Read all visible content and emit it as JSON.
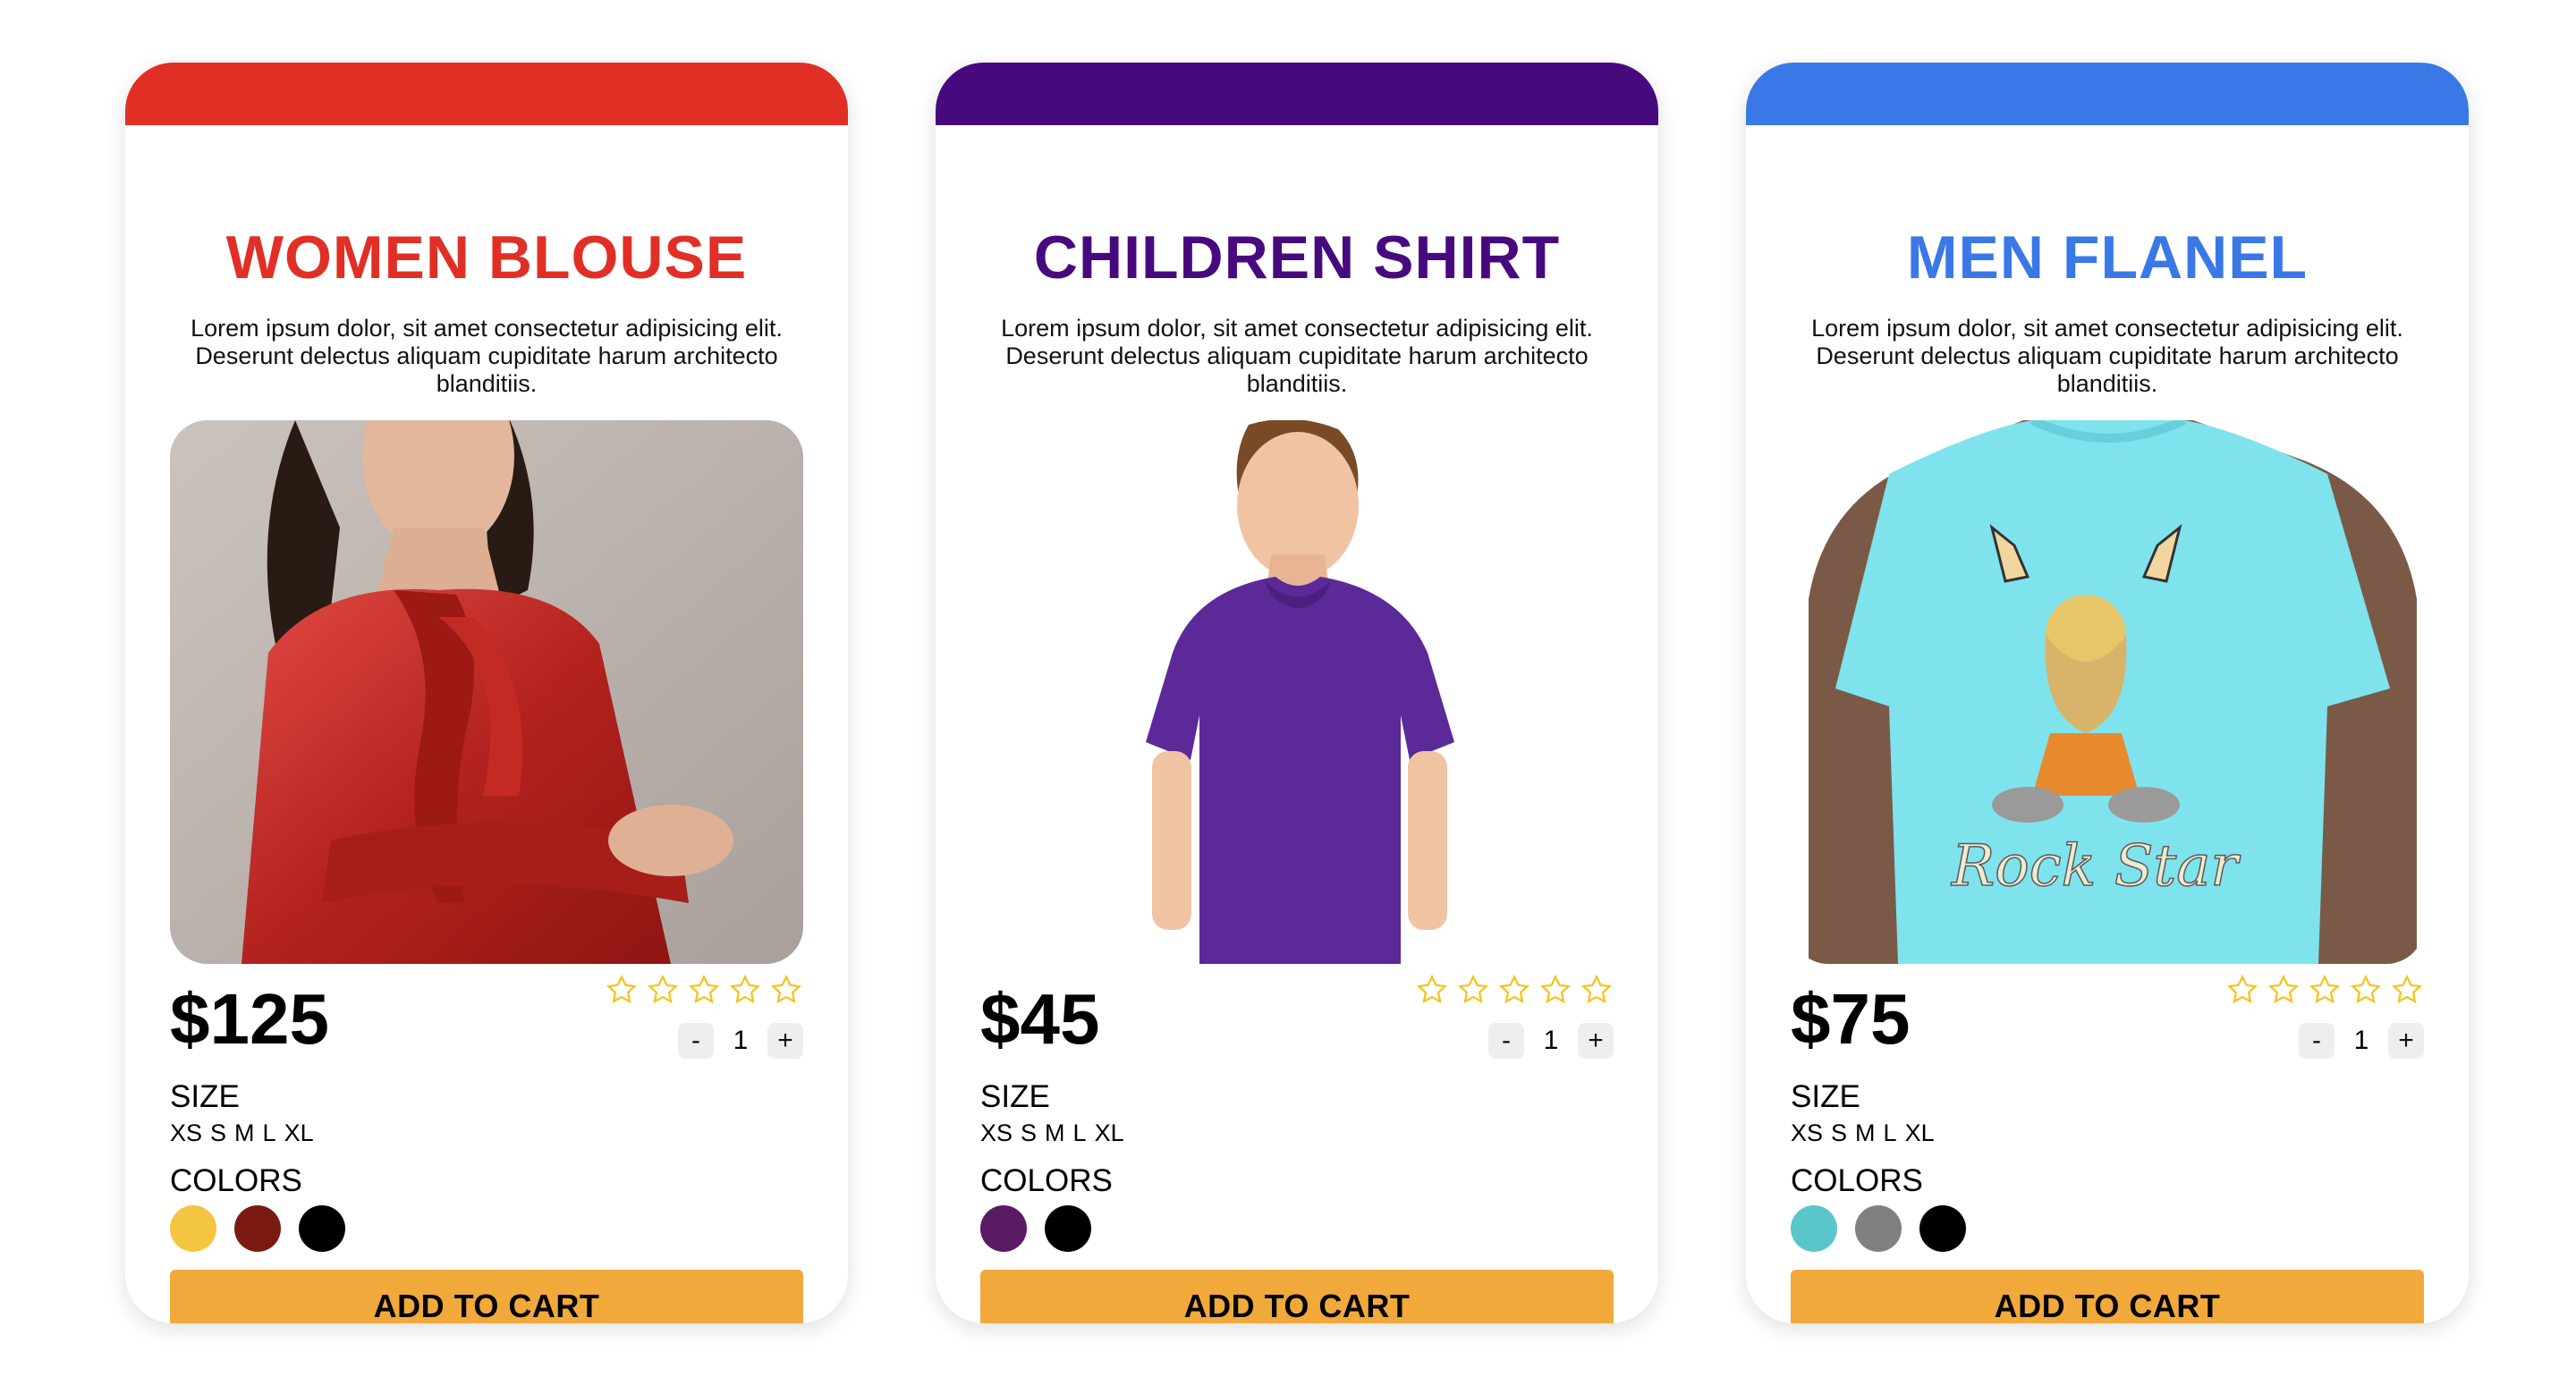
{
  "products": [
    {
      "title": "WOMEN BLOUSE",
      "accent": "#e12f25",
      "description": "Lorem ipsum dolor, sit amet consectetur adipisicing elit. Deserunt delectus aliquam cupiditate harum architecto blanditiis.",
      "image_icon": "woman-red-blouse-photo",
      "price": "$125",
      "rating_stars": 5,
      "quantity": "1",
      "qty_minus": "-",
      "qty_plus": "+",
      "size_label": "SIZE",
      "sizes": [
        "XS",
        "S",
        "M",
        "L",
        "XL"
      ],
      "colors_label": "COLORS",
      "colors": [
        "#f4c542",
        "#7b1a10",
        "#000000"
      ],
      "cart_label": "ADD TO CART"
    },
    {
      "title": "CHILDREN SHIRT",
      "accent": "#470a7e",
      "description": "Lorem ipsum dolor, sit amet consectetur adipisicing elit. Deserunt delectus aliquam cupiditate harum architecto blanditiis.",
      "image_icon": "boy-purple-shirt-photo",
      "price": "$45",
      "rating_stars": 5,
      "quantity": "1",
      "qty_minus": "-",
      "qty_plus": "+",
      "size_label": "SIZE",
      "sizes": [
        "XS",
        "S",
        "M",
        "L",
        "XL"
      ],
      "colors_label": "COLORS",
      "colors": [
        "#5a1a64",
        "#000000"
      ],
      "cart_label": "ADD TO CART"
    },
    {
      "title": "MEN FLANEL",
      "accent": "#3a78e8",
      "description": "Lorem ipsum dolor, sit amet consectetur adipisicing elit. Deserunt delectus aliquam cupiditate harum architecto blanditiis.",
      "image_icon": "cyan-tshirt-photo",
      "image_text": "Rock Star",
      "price": "$75",
      "rating_stars": 5,
      "quantity": "1",
      "qty_minus": "-",
      "qty_plus": "+",
      "size_label": "SIZE",
      "sizes": [
        "XS",
        "S",
        "M",
        "L",
        "XL"
      ],
      "colors_label": "COLORS",
      "colors": [
        "#5bc5cc",
        "#808080",
        "#000000"
      ],
      "cart_label": "ADD TO CART"
    }
  ],
  "star_color": "#f6c21a"
}
